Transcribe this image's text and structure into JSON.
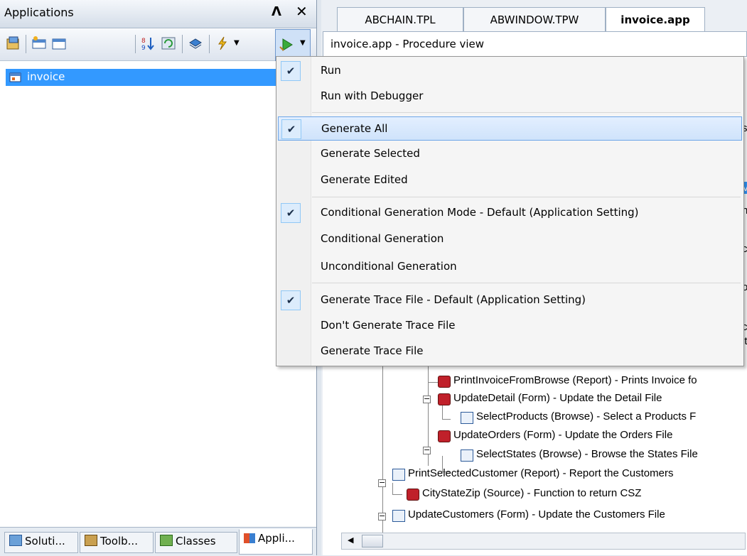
{
  "left_pane": {
    "title": "Applications",
    "pin_glyph": "Ʌ",
    "close_glyph": "✕",
    "tree": {
      "root_label": "invoice"
    },
    "bottom_tabs": [
      "Soluti...",
      "Toolb...",
      "Classes",
      "Appli..."
    ]
  },
  "editor": {
    "tabs": [
      "ABCHAIN.TPL",
      "ABWINDOW.TPW",
      "invoice.app"
    ],
    "active_tab_index": 2,
    "header": "invoice.app - Procedure view",
    "procedures": [
      "PrintInvoiceFromBrowse (Report) - Prints Invoice fo",
      "UpdateDetail (Form) - Update the Detail File",
      "SelectProducts (Browse) - Select a Products F",
      "UpdateOrders (Form) - Update the Orders File",
      "SelectStates (Browse) - Browse the States File",
      "PrintSelectedCustomer (Report) - Report the Customers",
      "CityStateZip (Source) - Function to return CSZ",
      "UpdateCustomers (Form) - Update the Customers File"
    ],
    "clipped_edge_chars": [
      "s",
      "V",
      "h",
      "c",
      "o",
      "c",
      "it"
    ]
  },
  "menu": {
    "groups": [
      [
        {
          "label": "Run",
          "checked": true
        },
        {
          "label": "Run with Debugger",
          "checked": false
        }
      ],
      [
        {
          "label": "Generate All",
          "checked": true,
          "highlighted": true
        },
        {
          "label": "Generate Selected",
          "checked": false
        },
        {
          "label": "Generate Edited",
          "checked": false
        }
      ],
      [
        {
          "label": "Conditional Generation Mode - Default (Application Setting)",
          "checked": true
        },
        {
          "label": "Conditional Generation",
          "checked": false
        },
        {
          "label": "Unconditional Generation",
          "checked": false
        }
      ],
      [
        {
          "label": "Generate Trace File - Default (Application Setting)",
          "checked": true
        },
        {
          "label": "Don't Generate Trace File",
          "checked": false
        },
        {
          "label": "Generate Trace File",
          "checked": false
        }
      ]
    ],
    "check_glyph": "✔"
  },
  "colors": {
    "selection": "#3399ff",
    "menu_highlight_border": "#6ea6e8"
  }
}
